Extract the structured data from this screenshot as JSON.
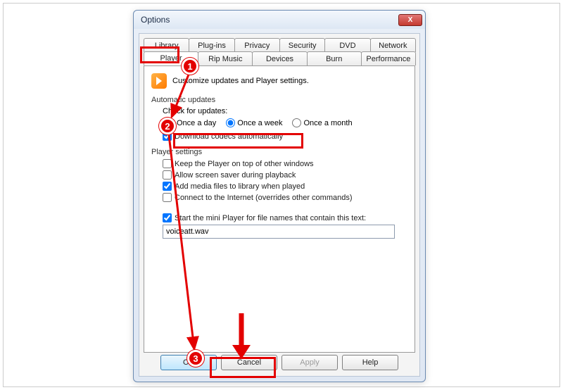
{
  "window": {
    "title": "Options",
    "close_x": "X"
  },
  "tabs_row1": [
    {
      "label": "Library"
    },
    {
      "label": "Plug-ins"
    },
    {
      "label": "Privacy"
    },
    {
      "label": "Security"
    },
    {
      "label": "DVD"
    },
    {
      "label": "Network"
    }
  ],
  "tabs_row2": [
    {
      "label": "Player"
    },
    {
      "label": "Rip Music"
    },
    {
      "label": "Devices"
    },
    {
      "label": "Burn"
    },
    {
      "label": "Performance"
    }
  ],
  "header_text": "Customize updates and Player settings.",
  "auto_updates": {
    "title": "Automatic updates",
    "subtitle": "Check for updates:",
    "opt_day": "Once a day",
    "opt_week": "Once a week",
    "opt_month": "Once a month",
    "download_codecs": "Download codecs automatically"
  },
  "player_settings": {
    "title": "Player settings",
    "keep_on_top": "Keep the Player on top of other windows",
    "screen_saver": "Allow screen saver during playback",
    "add_media": "Add media files to library when played",
    "internet": "Connect to the Internet (overrides other commands)",
    "mini_player": "Start the mini Player for file names that contain this text:",
    "mini_value": "voiceatt.wav"
  },
  "buttons": {
    "ok": "OK",
    "cancel": "Cancel",
    "apply": "Apply",
    "help": "Help"
  },
  "annotations": {
    "m1": "1",
    "m2": "2",
    "m3": "3"
  }
}
